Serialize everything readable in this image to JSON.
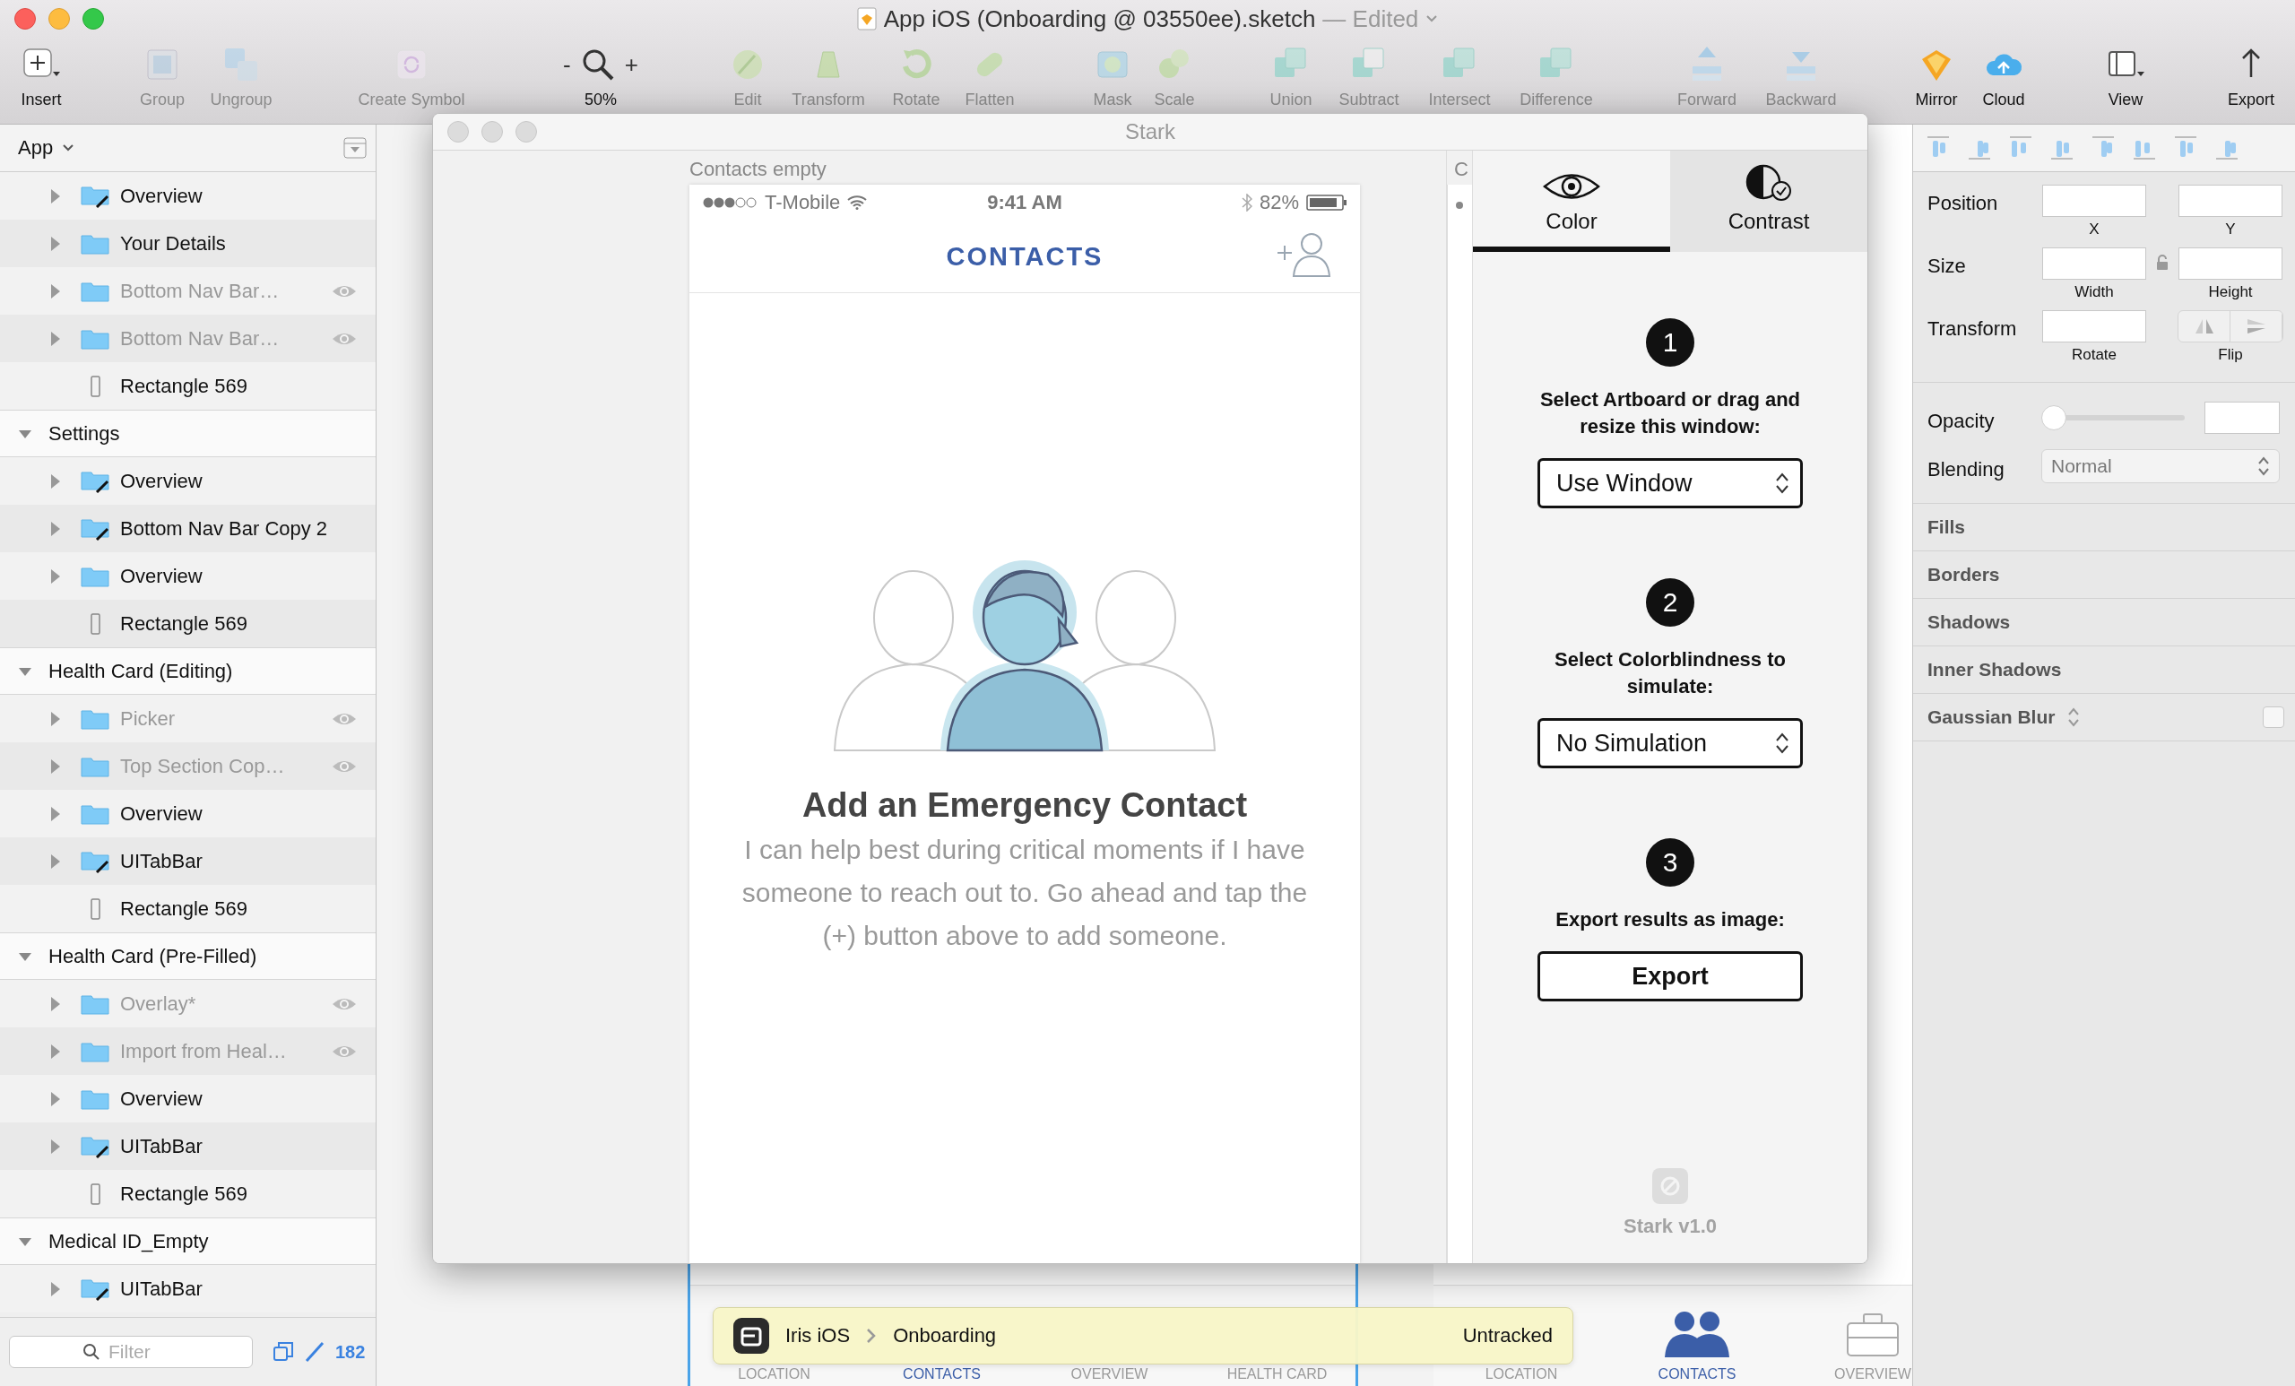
{
  "window": {
    "title": "App iOS (Onboarding @ 03550ee).sketch",
    "status": "— Edited"
  },
  "toolbar": [
    {
      "kind": "button",
      "label": "Insert",
      "disabled": false
    },
    {
      "kind": "button",
      "label": "Group",
      "disabled": true
    },
    {
      "kind": "button",
      "label": "Ungroup",
      "disabled": true
    },
    {
      "kind": "button",
      "label": "Create Symbol",
      "disabled": true
    },
    {
      "kind": "zoom",
      "label": "50%",
      "decrease": "-",
      "increase": "+",
      "disabled": false
    },
    {
      "kind": "button",
      "label": "Edit",
      "disabled": true
    },
    {
      "kind": "button",
      "label": "Transform",
      "disabled": true
    },
    {
      "kind": "button",
      "label": "Rotate",
      "disabled": true
    },
    {
      "kind": "button",
      "label": "Flatten",
      "disabled": true
    },
    {
      "kind": "button",
      "label": "Mask",
      "disabled": true
    },
    {
      "kind": "button",
      "label": "Scale",
      "disabled": true
    },
    {
      "kind": "button",
      "label": "Union",
      "disabled": true
    },
    {
      "kind": "button",
      "label": "Subtract",
      "disabled": true
    },
    {
      "kind": "button",
      "label": "Intersect",
      "disabled": true
    },
    {
      "kind": "button",
      "label": "Difference",
      "disabled": true
    },
    {
      "kind": "button",
      "label": "Forward",
      "disabled": true
    },
    {
      "kind": "button",
      "label": "Backward",
      "disabled": true
    },
    {
      "kind": "button",
      "label": "Mirror",
      "disabled": false
    },
    {
      "kind": "button",
      "label": "Cloud",
      "disabled": false
    },
    {
      "kind": "button",
      "label": "View",
      "disabled": false
    },
    {
      "kind": "button",
      "label": "Export",
      "disabled": false
    }
  ],
  "layers": {
    "page": "App",
    "filter_placeholder": "Filter",
    "count": "182",
    "artboards": [
      {
        "children": [
          {
            "name": "Overview",
            "kind": "symbol",
            "hidden": false
          },
          {
            "name": "Your Details",
            "kind": "group",
            "hidden": false
          },
          {
            "name": "Bottom Nav Bar…",
            "kind": "group",
            "hidden": true
          },
          {
            "name": "Bottom Nav Bar…",
            "kind": "group",
            "hidden": true
          },
          {
            "name": "Rectangle 569",
            "kind": "shape",
            "hidden": false
          }
        ]
      },
      {
        "name": "Settings",
        "expanded": true,
        "children": [
          {
            "name": "Overview",
            "kind": "symbol",
            "hidden": false
          },
          {
            "name": "Bottom Nav Bar Copy 2",
            "kind": "symbol",
            "hidden": false
          },
          {
            "name": "Overview",
            "kind": "group",
            "hidden": false
          },
          {
            "name": "Rectangle 569",
            "kind": "shape",
            "hidden": false
          }
        ]
      },
      {
        "name": "Health Card (Editing)",
        "expanded": true,
        "children": [
          {
            "name": "Picker",
            "kind": "group",
            "hidden": true
          },
          {
            "name": "Top Section Cop…",
            "kind": "group",
            "hidden": true
          },
          {
            "name": "Overview",
            "kind": "group",
            "hidden": false
          },
          {
            "name": "UITabBar",
            "kind": "symbol",
            "hidden": false
          },
          {
            "name": "Rectangle 569",
            "kind": "shape",
            "hidden": false
          }
        ]
      },
      {
        "name": "Health Card (Pre-Filled)",
        "expanded": true,
        "children": [
          {
            "name": "Overlay*",
            "kind": "group",
            "hidden": true
          },
          {
            "name": "Import from Heal…",
            "kind": "group",
            "hidden": true
          },
          {
            "name": "Overview",
            "kind": "group",
            "hidden": false
          },
          {
            "name": "UITabBar",
            "kind": "symbol",
            "hidden": false
          },
          {
            "name": "Rectangle 569",
            "kind": "shape",
            "hidden": false
          }
        ]
      },
      {
        "name": "Medical ID_Empty",
        "expanded": true,
        "children": [
          {
            "name": "UITabBar",
            "kind": "symbol",
            "hidden": false
          }
        ]
      }
    ]
  },
  "stark": {
    "title": "Stark",
    "artboard_label": "Contacts empty",
    "side_artboard_label": "C",
    "tabs": [
      {
        "label": "Color",
        "selected": true
      },
      {
        "label": "Contrast",
        "selected": false
      }
    ],
    "steps": [
      {
        "number": "1",
        "text": "Select Artboard or drag and resize this window:",
        "kind": "select",
        "value": "Use Window"
      },
      {
        "number": "2",
        "text": "Select Colorblindness to simulate:",
        "kind": "select",
        "value": "No Simulation"
      },
      {
        "number": "3",
        "text": "Export results as image:",
        "kind": "button",
        "value": "Export"
      }
    ],
    "version": "Stark v1.0"
  },
  "phone": {
    "carrier": "T-Mobile",
    "time": "9:41 AM",
    "battery": "82%",
    "title": "CONTACTS",
    "heading": "Add an Emergency Contact",
    "body": "I can help best during critical moments if I have someone to reach out to. Go ahead and tap the (+) button above to add someone."
  },
  "tab_bars": [
    {
      "tabs": [
        {
          "label": "LOCATION",
          "selected": false
        },
        {
          "label": "CONTACTS",
          "selected": true
        },
        {
          "label": "OVERVIEW",
          "selected": false
        },
        {
          "label": "HEALTH CARD",
          "selected": false
        }
      ]
    },
    {
      "tabs": [
        {
          "label": "LOCATION",
          "selected": false
        },
        {
          "label": "CONTACTS",
          "selected": true
        },
        {
          "label": "OVERVIEW",
          "selected": false
        }
      ]
    }
  ],
  "notification": {
    "project": "Iris iOS",
    "branch": "Onboarding",
    "status": "Untracked"
  },
  "inspector": {
    "rows": [
      {
        "kind": "pair",
        "label": "Position",
        "fields": [
          "X",
          "Y"
        ]
      },
      {
        "kind": "locked-pair",
        "label": "Size",
        "fields": [
          "Width",
          "Height"
        ]
      },
      {
        "kind": "rotate-flip",
        "label": "Transform",
        "fields": [
          "Rotate",
          "Flip"
        ]
      }
    ],
    "opacity": {
      "label": "Opacity",
      "level": 0
    },
    "blending": {
      "label": "Blending",
      "value": "Normal"
    },
    "sections": [
      {
        "kind": "plain",
        "label": "Fills"
      },
      {
        "kind": "plain",
        "label": "Borders"
      },
      {
        "kind": "plain",
        "label": "Shadows"
      },
      {
        "kind": "plain",
        "label": "Inner Shadows"
      },
      {
        "kind": "toggle",
        "label": "Gaussian Blur",
        "checked": false
      }
    ]
  }
}
